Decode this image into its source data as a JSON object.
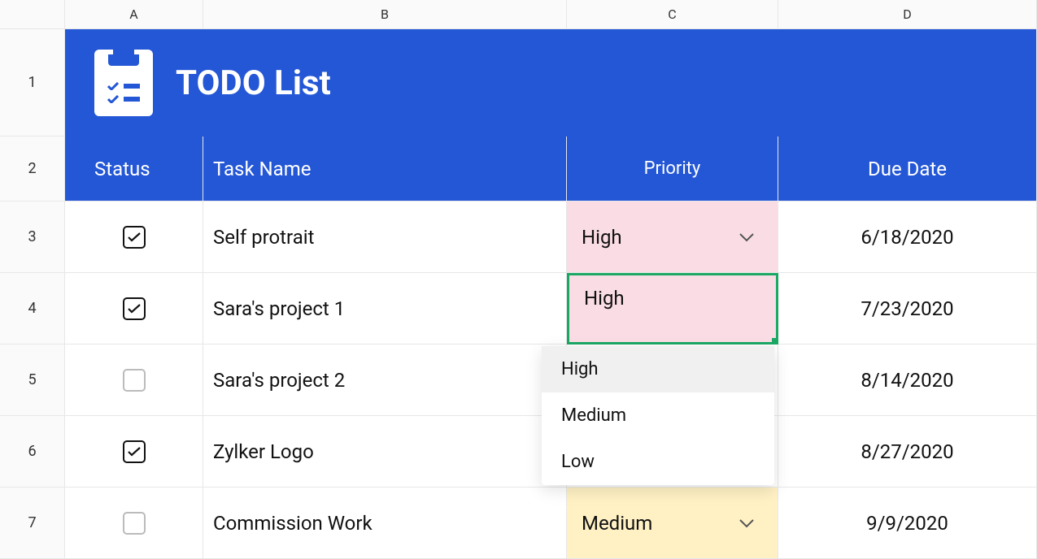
{
  "columns": [
    "A",
    "B",
    "C",
    "D"
  ],
  "row_numbers": [
    "1",
    "2",
    "3",
    "4",
    "5",
    "6",
    "7"
  ],
  "title": "TODO List",
  "headers": {
    "status": "Status",
    "task_name": "Task Name",
    "priority": "Priority",
    "due_date": "Due Date"
  },
  "rows": [
    {
      "checked": true,
      "task": "Self protrait",
      "priority": "High",
      "priority_class": "priority-high",
      "show_chevron": true,
      "due": "6/18/2020"
    },
    {
      "checked": true,
      "task": "Sara's project 1",
      "priority": "High",
      "priority_class": "priority-high",
      "show_chevron": false,
      "due": "7/23/2020",
      "selected": true
    },
    {
      "checked": false,
      "task": "Sara's project 2",
      "priority": "",
      "priority_class": "priority-low",
      "show_chevron": false,
      "due": "8/14/2020"
    },
    {
      "checked": true,
      "task": "Zylker Logo",
      "priority": "",
      "priority_class": "priority-low",
      "show_chevron": false,
      "due": "8/27/2020"
    },
    {
      "checked": false,
      "task": "Commission Work",
      "priority": "Medium",
      "priority_class": "priority-medium",
      "show_chevron": true,
      "due": "9/9/2020"
    }
  ],
  "dropdown": {
    "options": [
      "High",
      "Medium",
      "Low"
    ],
    "hovered_index": 0
  },
  "colors": {
    "brand": "#2457D6",
    "high_bg": "#FADDE4",
    "medium_bg": "#FFF1C4",
    "selection": "#1BA865"
  }
}
